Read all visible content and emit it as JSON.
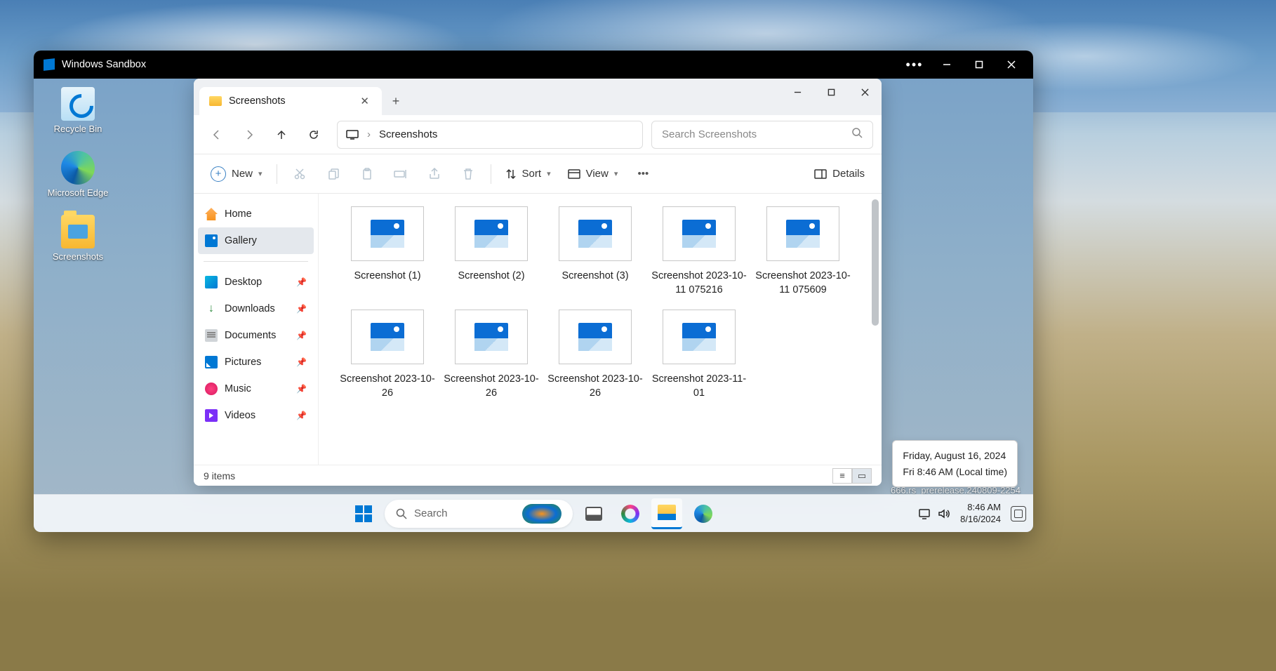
{
  "sandbox": {
    "title": "Windows Sandbox"
  },
  "desktop_icons": {
    "recycle": "Recycle Bin",
    "edge": "Microsoft Edge",
    "screenshots": "Screenshots"
  },
  "explorer": {
    "tab_title": "Screenshots",
    "breadcrumb": "Screenshots",
    "search_placeholder": "Search Screenshots",
    "toolbar": {
      "new": "New",
      "sort": "Sort",
      "view": "View",
      "details": "Details"
    },
    "sidebar": {
      "home": "Home",
      "gallery": "Gallery",
      "desktop": "Desktop",
      "downloads": "Downloads",
      "documents": "Documents",
      "pictures": "Pictures",
      "music": "Music",
      "videos": "Videos"
    },
    "files": [
      "Screenshot (1)",
      "Screenshot (2)",
      "Screenshot (3)",
      "Screenshot 2023-10-11 075216",
      "Screenshot 2023-10-11 075609",
      "Screenshot 2023-10-26",
      "Screenshot 2023-10-26",
      "Screenshot 2023-10-26",
      "Screenshot 2023-11-01"
    ],
    "status": "9 items"
  },
  "tooltip": {
    "line1": "Friday, August 16, 2024",
    "line2": "Fri 8:46 AM (Local time)"
  },
  "watermark": "666.rs_prerelease.240809-2254",
  "taskbar": {
    "search": "Search",
    "clock_time": "8:46 AM",
    "clock_date": "8/16/2024"
  }
}
